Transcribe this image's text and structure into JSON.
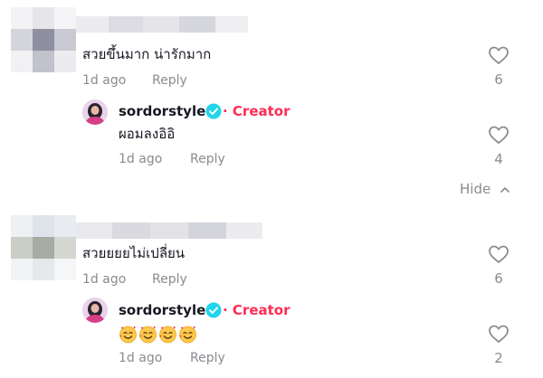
{
  "comments": [
    {
      "text": "สวยขึ้นมาก น่ารักมาก",
      "time": "1d ago",
      "reply_label": "Reply",
      "likes": "6",
      "replies": [
        {
          "username": "sordorstyle",
          "badge": "Creator",
          "text": "ผอมลงอิอิ",
          "time": "1d ago",
          "reply_label": "Reply",
          "likes": "4"
        }
      ],
      "hide_label": "Hide"
    },
    {
      "text": "สวยยยยไม่เปลี่ยน",
      "time": "1d ago",
      "reply_label": "Reply",
      "likes": "6",
      "replies": [
        {
          "username": "sordorstyle",
          "badge": "Creator",
          "emoji": [
            "smiling-face-with-hearts",
            "smiling-face-with-hearts",
            "smiling-face-with-hearts",
            "smiling-face-with-hearts"
          ],
          "time": "1d ago",
          "reply_label": "Reply",
          "likes": "2"
        }
      ]
    }
  ],
  "colors": {
    "creator": "#fe2c55",
    "verified": "#20d5ec",
    "muted": "#8a8b91",
    "text": "#161823"
  }
}
